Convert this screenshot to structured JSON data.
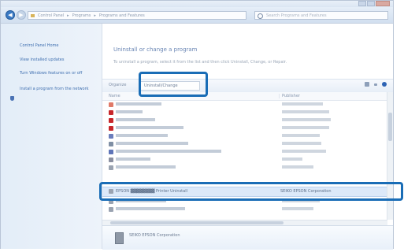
{
  "address": {
    "crumbs": [
      "Control Panel",
      "Programs",
      "Programs and Features"
    ]
  },
  "search": {
    "placeholder": "Search Programs and Features"
  },
  "sidebar": {
    "items": [
      {
        "label": "Control Panel Home"
      },
      {
        "label": "View installed updates"
      },
      {
        "label": "Turn Windows features on or off"
      },
      {
        "label": "Install a program from the network"
      }
    ]
  },
  "main": {
    "heading": "Uninstall or change a program",
    "subtext": "To uninstall a program, select it from the list and then click Uninstall, Change, or Repair."
  },
  "toolbar": {
    "organize_label": "Organize",
    "uninstall_label": "Uninstall/Change"
  },
  "columns": {
    "name": "Name",
    "publisher": "Publisher"
  },
  "selected_row": {
    "name": "EPSON ▓▓▓▓▓▓▓▓ Printer Uninstall",
    "publisher": "SEIKO EPSON Corporation"
  },
  "details": {
    "publisher": "SEIKO EPSON Corporation"
  },
  "colors": {
    "highlight": "#1a6db6",
    "selection": "#dce9f9"
  }
}
